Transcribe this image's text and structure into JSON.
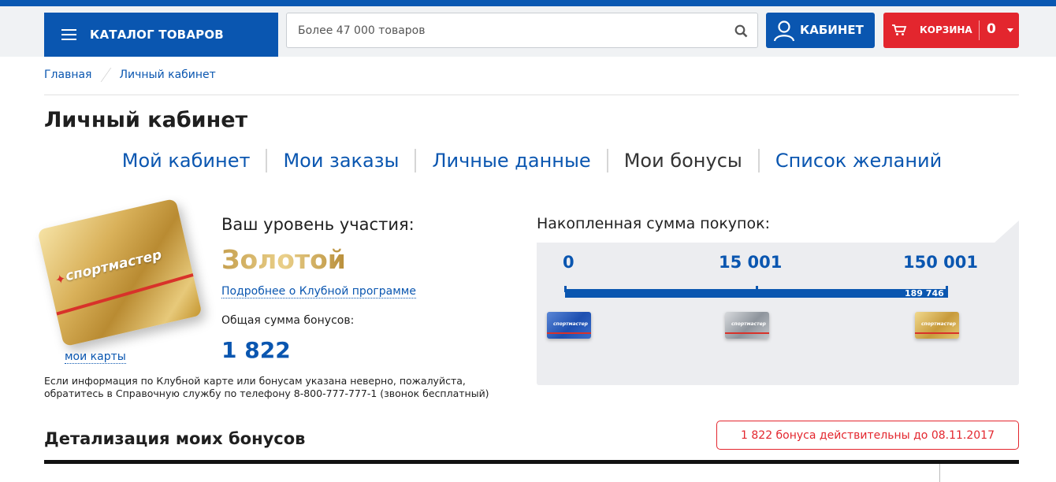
{
  "header": {
    "catalog_label": "КАТАЛОГ ТОВАРОВ",
    "search_placeholder": "Более 47 000 товаров",
    "cabinet_label": "КАБИНЕТ",
    "cart_label": "КОРЗИНА",
    "cart_count": "0"
  },
  "breadcrumb": {
    "items": [
      {
        "label": "Главная"
      },
      {
        "label": "Личный кабинет"
      }
    ]
  },
  "page": {
    "title": "Личный кабинет"
  },
  "tabs": [
    {
      "label": "Мой кабинет",
      "active": false
    },
    {
      "label": "Мои заказы",
      "active": false
    },
    {
      "label": "Личные данные",
      "active": false
    },
    {
      "label": "Мои бонусы",
      "active": true
    },
    {
      "label": "Список желаний",
      "active": false
    }
  ],
  "card": {
    "brand": "спортмастер",
    "my_cards_link": "мои карты"
  },
  "level": {
    "caption": "Ваш уровень участия:",
    "name": "Золотой",
    "more_link": "Подробнее о Клубной программе",
    "bonus_caption": "Общая сумма бонусов:",
    "bonus_total": "1 822"
  },
  "info_text": "Если информация по Клубной карте или бонусам указана неверно, пожалуйста, обратитесь в Справочную службу по телефону 8-800-777-777-1 (звонок бесплатный)",
  "progress": {
    "caption": "Накопленная сумма покупок:",
    "thresholds": [
      "0",
      "15 001",
      "150 001"
    ],
    "current_value": "189 746",
    "card_levels": [
      "blue-card",
      "silver-card",
      "gold-card"
    ]
  },
  "details": {
    "title": "Детализация моих бонусов",
    "validity": "1 822 бонуса действительны до 08.11.2017"
  },
  "colors": {
    "brand_blue": "#0a56b0",
    "accent_red": "#e3262e",
    "header_bg": "#f0f2f4",
    "panel_bg": "#ecedf0"
  }
}
